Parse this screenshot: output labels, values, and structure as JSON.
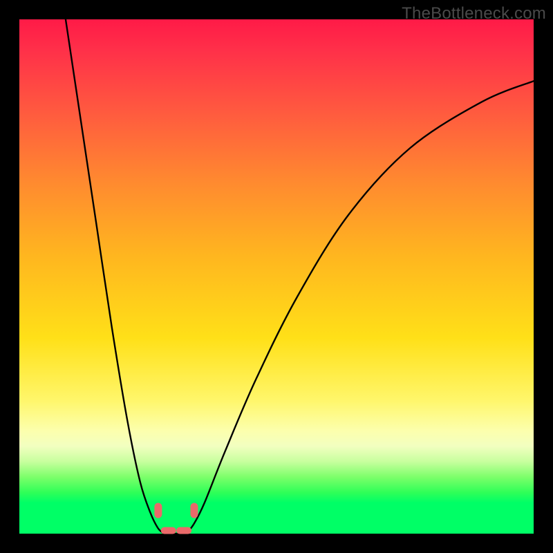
{
  "watermark": "TheBottleneck.com",
  "colors": {
    "gradient_top": "#ff1a47",
    "gradient_mid_orange": "#ff8b2f",
    "gradient_mid_yellow": "#ffe018",
    "gradient_pale": "#fcffad",
    "gradient_bottom": "#00ff66",
    "curve": "#000000",
    "marker": "#ea6a6a",
    "frame": "#000000"
  },
  "chart_data": {
    "type": "line",
    "title": "",
    "xlabel": "",
    "ylabel": "",
    "xlim": [
      0,
      100
    ],
    "ylim": [
      0,
      100
    ],
    "note": "Two V-curves meeting near the bottom; y ≈ 100 means severe bottleneck (red), y ≈ 0 means balanced (green). Values estimated from pixel heights since no axis ticks are shown.",
    "series": [
      {
        "name": "left-branch",
        "x": [
          9,
          12,
          15,
          18,
          21,
          23.5,
          25.5,
          27,
          28.2
        ],
        "y": [
          100,
          80,
          60,
          40,
          22,
          10,
          4,
          1,
          0
        ]
      },
      {
        "name": "right-branch",
        "x": [
          32.5,
          34,
          36,
          40,
          46,
          54,
          64,
          76,
          90,
          100
        ],
        "y": [
          0,
          2,
          6,
          16,
          30,
          46,
          62,
          75,
          84,
          88
        ]
      },
      {
        "name": "floor-segment",
        "x": [
          28.2,
          32.5
        ],
        "y": [
          0,
          0
        ]
      }
    ],
    "markers": [
      {
        "name": "left-intersection",
        "x": 27.0,
        "y": 4.5
      },
      {
        "name": "right-intersection",
        "x": 34.0,
        "y": 4.5
      },
      {
        "name": "bottom-left",
        "x": 29.0,
        "y": 0.6
      },
      {
        "name": "bottom-right",
        "x": 32.0,
        "y": 0.6
      }
    ]
  }
}
